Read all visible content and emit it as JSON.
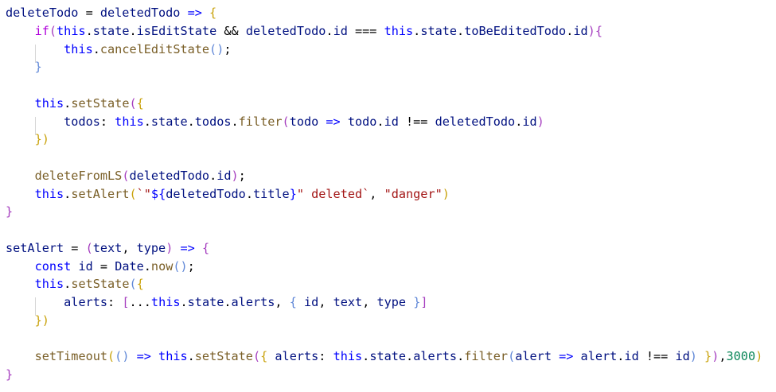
{
  "code": {
    "lines": [
      [
        [
          "deleteTodo",
          "var"
        ],
        [
          " = ",
          "op"
        ],
        [
          "deletedTodo",
          "var"
        ],
        [
          " => ",
          "kw"
        ],
        [
          "{",
          "b-y"
        ]
      ],
      [
        [
          "    ",
          "op"
        ],
        [
          "if",
          "ctl"
        ],
        [
          "(",
          "b-p"
        ],
        [
          "this",
          "kw"
        ],
        [
          ".",
          "op"
        ],
        [
          "state",
          "var"
        ],
        [
          ".",
          "op"
        ],
        [
          "isEditState",
          "var"
        ],
        [
          " && ",
          "op"
        ],
        [
          "deletedTodo",
          "var"
        ],
        [
          ".",
          "op"
        ],
        [
          "id",
          "var"
        ],
        [
          " === ",
          "op"
        ],
        [
          "this",
          "kw"
        ],
        [
          ".",
          "op"
        ],
        [
          "state",
          "var"
        ],
        [
          ".",
          "op"
        ],
        [
          "toBeEditedTodo",
          "var"
        ],
        [
          ".",
          "op"
        ],
        [
          "id",
          "var"
        ],
        [
          ")",
          "b-p"
        ],
        [
          "{",
          "b-p"
        ]
      ],
      [
        [
          "        ",
          "op"
        ],
        [
          "this",
          "kw"
        ],
        [
          ".",
          "op"
        ],
        [
          "cancelEditState",
          "fn"
        ],
        [
          "()",
          "b-b"
        ],
        [
          ";",
          "op"
        ]
      ],
      [
        [
          "    ",
          "op"
        ],
        [
          "}",
          "b-b"
        ]
      ],
      [
        [
          "",
          "op"
        ]
      ],
      [
        [
          "    ",
          "op"
        ],
        [
          "this",
          "kw"
        ],
        [
          ".",
          "op"
        ],
        [
          "setState",
          "fn"
        ],
        [
          "(",
          "b-p"
        ],
        [
          "{",
          "b-y"
        ]
      ],
      [
        [
          "        ",
          "op"
        ],
        [
          "todos",
          "var"
        ],
        [
          ": ",
          "op"
        ],
        [
          "this",
          "kw"
        ],
        [
          ".",
          "op"
        ],
        [
          "state",
          "var"
        ],
        [
          ".",
          "op"
        ],
        [
          "todos",
          "var"
        ],
        [
          ".",
          "op"
        ],
        [
          "filter",
          "fn"
        ],
        [
          "(",
          "b-p"
        ],
        [
          "todo",
          "var"
        ],
        [
          " => ",
          "kw"
        ],
        [
          "todo",
          "var"
        ],
        [
          ".",
          "op"
        ],
        [
          "id",
          "var"
        ],
        [
          " !== ",
          "op"
        ],
        [
          "deletedTodo",
          "var"
        ],
        [
          ".",
          "op"
        ],
        [
          "id",
          "var"
        ],
        [
          ")",
          "b-p"
        ]
      ],
      [
        [
          "    ",
          "op"
        ],
        [
          "})",
          "b-y"
        ]
      ],
      [
        [
          "",
          "op"
        ]
      ],
      [
        [
          "    ",
          "op"
        ],
        [
          "deleteFromLS",
          "fn"
        ],
        [
          "(",
          "b-p"
        ],
        [
          "deletedTodo",
          "var"
        ],
        [
          ".",
          "op"
        ],
        [
          "id",
          "var"
        ],
        [
          ")",
          "b-p"
        ],
        [
          ";",
          "op"
        ]
      ],
      [
        [
          "    ",
          "op"
        ],
        [
          "this",
          "kw"
        ],
        [
          ".",
          "op"
        ],
        [
          "setAlert",
          "fn"
        ],
        [
          "(",
          "b-y"
        ],
        [
          "`\"",
          "str"
        ],
        [
          "${",
          "kw"
        ],
        [
          "deletedTodo",
          "var"
        ],
        [
          ".",
          "op"
        ],
        [
          "title",
          "var"
        ],
        [
          "}",
          "kw"
        ],
        [
          "\" deleted`",
          "str"
        ],
        [
          ", ",
          "op"
        ],
        [
          "\"danger\"",
          "str"
        ],
        [
          ")",
          "b-y"
        ]
      ],
      [
        [
          "}",
          "b-p"
        ]
      ],
      [
        [
          "",
          "op"
        ]
      ],
      [
        [
          "setAlert",
          "var"
        ],
        [
          " = ",
          "op"
        ],
        [
          "(",
          "b-p"
        ],
        [
          "text",
          "var"
        ],
        [
          ", ",
          "op"
        ],
        [
          "type",
          "var"
        ],
        [
          ")",
          "b-p"
        ],
        [
          " => ",
          "kw"
        ],
        [
          "{",
          "b-p"
        ]
      ],
      [
        [
          "    ",
          "op"
        ],
        [
          "const",
          "kw"
        ],
        [
          " ",
          "op"
        ],
        [
          "id",
          "var"
        ],
        [
          " = ",
          "op"
        ],
        [
          "Date",
          "var"
        ],
        [
          ".",
          "op"
        ],
        [
          "now",
          "fn"
        ],
        [
          "()",
          "b-b"
        ],
        [
          ";",
          "op"
        ]
      ],
      [
        [
          "    ",
          "op"
        ],
        [
          "this",
          "kw"
        ],
        [
          ".",
          "op"
        ],
        [
          "setState",
          "fn"
        ],
        [
          "(",
          "b-b"
        ],
        [
          "{",
          "b-y"
        ]
      ],
      [
        [
          "        ",
          "op"
        ],
        [
          "alerts",
          "var"
        ],
        [
          ": ",
          "op"
        ],
        [
          "[",
          "b-p"
        ],
        [
          "...",
          "op"
        ],
        [
          "this",
          "kw"
        ],
        [
          ".",
          "op"
        ],
        [
          "state",
          "var"
        ],
        [
          ".",
          "op"
        ],
        [
          "alerts",
          "var"
        ],
        [
          ", ",
          "op"
        ],
        [
          "{",
          "b-b"
        ],
        [
          " ",
          "op"
        ],
        [
          "id",
          "var"
        ],
        [
          ", ",
          "op"
        ],
        [
          "text",
          "var"
        ],
        [
          ", ",
          "op"
        ],
        [
          "type",
          "var"
        ],
        [
          " ",
          "op"
        ],
        [
          "}",
          "b-b"
        ],
        [
          "]",
          "b-p"
        ]
      ],
      [
        [
          "    ",
          "op"
        ],
        [
          "})",
          "b-y"
        ]
      ],
      [
        [
          "",
          "op"
        ]
      ],
      [
        [
          "    ",
          "op"
        ],
        [
          "setTimeout",
          "fn"
        ],
        [
          "(",
          "b-y"
        ],
        [
          "()",
          "b-b"
        ],
        [
          " => ",
          "kw"
        ],
        [
          "this",
          "kw"
        ],
        [
          ".",
          "op"
        ],
        [
          "setState",
          "fn"
        ],
        [
          "(",
          "b-p"
        ],
        [
          "{",
          "b-y"
        ],
        [
          " ",
          "op"
        ],
        [
          "alerts",
          "var"
        ],
        [
          ": ",
          "op"
        ],
        [
          "this",
          "kw"
        ],
        [
          ".",
          "op"
        ],
        [
          "state",
          "var"
        ],
        [
          ".",
          "op"
        ],
        [
          "alerts",
          "var"
        ],
        [
          ".",
          "op"
        ],
        [
          "filter",
          "fn"
        ],
        [
          "(",
          "b-b"
        ],
        [
          "alert",
          "var"
        ],
        [
          " => ",
          "kw"
        ],
        [
          "alert",
          "var"
        ],
        [
          ".",
          "op"
        ],
        [
          "id",
          "var"
        ],
        [
          " !== ",
          "op"
        ],
        [
          "id",
          "var"
        ],
        [
          ")",
          "b-b"
        ],
        [
          " ",
          "op"
        ],
        [
          "}",
          "b-y"
        ],
        [
          ")",
          "b-p"
        ],
        [
          ",",
          "op"
        ],
        [
          "3000",
          "num"
        ],
        [
          ")",
          "b-y"
        ]
      ],
      [
        [
          "}",
          "b-p"
        ]
      ]
    ],
    "colors": {
      "background": "#ffffff",
      "variable": "#001080",
      "function": "#795e26",
      "keyword": "#0000ff",
      "control": "#af00db",
      "string": "#a31515",
      "number": "#098658",
      "bracket_yellow": "#c9a20b",
      "bracket_purple": "#a53dbf",
      "bracket_blue": "#5f87d7",
      "indent_guide": "#d6d6d6"
    }
  }
}
